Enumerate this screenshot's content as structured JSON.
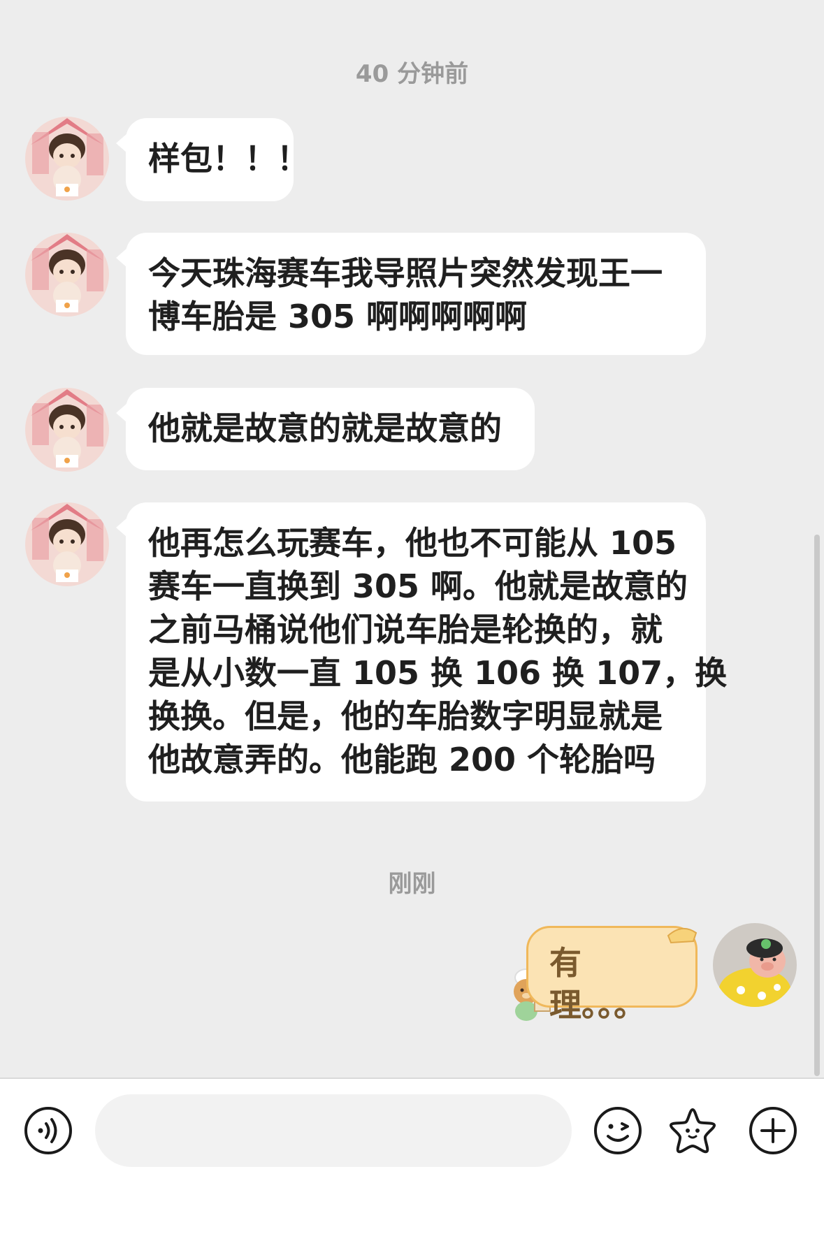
{
  "timestamps": {
    "first": "40 分钟前",
    "second": "刚刚"
  },
  "incoming_messages": [
    {
      "lines": [
        "样包！！！"
      ]
    },
    {
      "lines": [
        "今天珠海赛车我导照片突然发现王一",
        "博车胎是 305 啊啊啊啊啊"
      ]
    },
    {
      "lines": [
        "他就是故意的就是故意的"
      ]
    },
    {
      "lines": [
        "他再怎么玩赛车，他也不可能从 105",
        "赛车一直换到 305 啊。他就是故意的",
        "之前马桶说他们说车胎是轮换的，就",
        "是从小数一直 105 换 106 换 107，换",
        "换换。但是，他的车胎数字明显就是",
        "他故意弄的。他能跑 200 个轮胎吗"
      ]
    }
  ],
  "outgoing_message": {
    "text": "有理。。。"
  },
  "input": {
    "placeholder": "",
    "value": ""
  },
  "toolbar": {
    "voice": "voice-icon",
    "emoji": "emoji-icon",
    "sticker": "star-sticker-icon",
    "more": "plus-icon"
  },
  "colors": {
    "background": "#ededed",
    "bubble_in": "#ffffff",
    "bubble_out": "#fbe3b4",
    "bubble_out_border": "#f0b85a",
    "timestamp": "#9a9a9a"
  }
}
